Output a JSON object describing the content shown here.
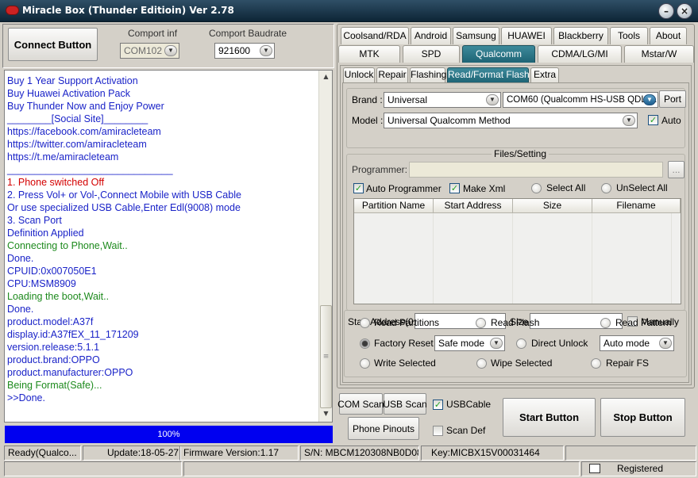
{
  "window": {
    "title": "Miracle Box (Thunder Editioin) Ver 2.78"
  },
  "left_panel": {
    "connect_button": "Connect Button",
    "comport_inf_label": "Comport inf",
    "comport_inf_value": "COM102",
    "comport_baud_label": "Comport Baudrate",
    "comport_baud_value": "921600"
  },
  "log": [
    {
      "text": "Buy 1 Year Support Activation",
      "color": "#1a23c8"
    },
    {
      "text": "Buy Huawei Activation Pack",
      "color": "#1a23c8"
    },
    {
      "text": "Buy Thunder Now and Enjoy Power",
      "color": "#1a23c8"
    },
    {
      "text": "________[Social Site]________",
      "color": "#1a23c8"
    },
    {
      "text": "https://facebook.com/amiracleteam",
      "color": "#1a23c8"
    },
    {
      "text": "https://twitter.com/amiracleteam",
      "color": "#1a23c8"
    },
    {
      "text": "https://t.me/amiracleteam",
      "color": "#1a23c8"
    },
    {
      "text": "______________________________",
      "color": "#1a23c8"
    },
    {
      "text": "  1. Phone switched Off",
      "color": "#d40000"
    },
    {
      "text": "  2. Press Vol+ or Vol-,Connect Mobile with USB Cable",
      "color": "#1a23c8"
    },
    {
      "text": "  Or use specialized USB Cable,Enter Edl(9008) mode",
      "color": "#1a23c8"
    },
    {
      "text": "  3. Scan Port",
      "color": "#1a23c8"
    },
    {
      "text": "  Definition Applied",
      "color": "#1a23c8"
    },
    {
      "text": "  Connecting to Phone,Wait..",
      "color": "#1d8a1d"
    },
    {
      "text": "  Done.",
      "color": "#1a23c8"
    },
    {
      "text": "  CPUID:0x007050E1",
      "color": "#1a23c8"
    },
    {
      "text": "  CPU:MSM8909",
      "color": "#1a23c8"
    },
    {
      "text": "  Loading the boot,Wait..",
      "color": "#1d8a1d"
    },
    {
      "text": "  Done.",
      "color": "#1a23c8"
    },
    {
      "text": "  product.model:A37f",
      "color": "#1a23c8"
    },
    {
      "text": "  display.id:A37fEX_11_171209",
      "color": "#1a23c8"
    },
    {
      "text": "  version.release:5.1.1",
      "color": "#1a23c8"
    },
    {
      "text": "  product.brand:OPPO",
      "color": "#1a23c8"
    },
    {
      "text": "  product.manufacturer:OPPO",
      "color": "#1a23c8"
    },
    {
      "text": "  Being Format(Safe)...",
      "color": "#1d8a1d"
    },
    {
      "text": ">>Done.",
      "color": "#1a23c8"
    }
  ],
  "progress": {
    "label": "100%",
    "value": 1.0
  },
  "tabs_row1": [
    "Coolsand/RDA",
    "Android",
    "Samsung",
    "HUAWEI",
    "Blackberry",
    "Tools",
    "About"
  ],
  "tabs_row2": [
    "MTK",
    "SPD",
    "Qualcomm",
    "CDMA/LG/MI",
    "Mstar/W"
  ],
  "subtabs": [
    "Unlock",
    "Repair",
    "Flashing",
    "Read/Format Flash",
    "Extra"
  ],
  "brand": {
    "label": "Brand :",
    "value": "Universal",
    "port_value": "COM60 (Qualcomm HS-USB QDLoa",
    "port_button": "Port"
  },
  "model": {
    "label": "Model :",
    "value": "Universal Qualcomm Method",
    "auto_label": "Auto"
  },
  "files": {
    "title": "Files/Setting",
    "programmer_label": "Programmer:",
    "browse": "...",
    "auto_programmer": "Auto Programmer",
    "make_xml": "Make Xml",
    "select_all": "Select All",
    "unselect_all": "UnSelect All",
    "columns": [
      "Partition Name",
      "Start Address",
      "Size",
      "Filename"
    ],
    "start_address_label": "Start Address(0x)",
    "size_label": "Size :",
    "manually_label": "Manually"
  },
  "options": {
    "read_partitions": "Read Partitions",
    "read_flash": "Read Flash",
    "read_pattern": "Read Pattern",
    "factory_reset": "Factory Reset",
    "reset_mode": "Safe mode",
    "direct_unlock": "Direct Unlock",
    "unlock_mode": "Auto mode",
    "write_selected": "Write Selected",
    "wipe_selected": "Wipe Selected",
    "repair_fs": "Repair FS"
  },
  "bottom": {
    "com_scan": "COM Scan",
    "usb_scan": "USB Scan",
    "usb_cable": "USBCable",
    "phone_pinouts": "Phone Pinouts",
    "scan_def": "Scan Def",
    "start": "Start Button",
    "stop": "Stop Button"
  },
  "statusbar": {
    "state": "Ready(Qualco...",
    "update": "Update:18-05-27",
    "firmware": "Firmware Version:1.17",
    "serial": "S/N: MBCM120308NB0D08",
    "key": "Key:MICBX15V00031464",
    "registered": "Registered"
  }
}
